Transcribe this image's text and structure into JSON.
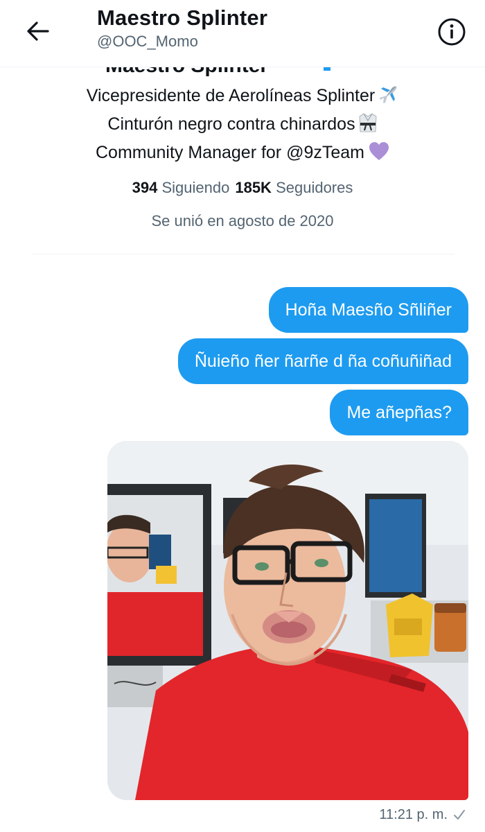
{
  "header": {
    "title": "Maestro Splinter",
    "handle": "@OOC_Momo",
    "back_icon": "arrow-left-icon",
    "info_icon": "info-circle-icon"
  },
  "profile": {
    "name_cutoff": "Maestro Splinter",
    "bio": [
      {
        "text": "Vicepresidente de Aerolíneas Splinter",
        "emoji": "airplane"
      },
      {
        "text": "Cinturón negro contra chinardos",
        "emoji": "martial-arts-uniform"
      },
      {
        "text": "Community Manager for @9zTeam",
        "emoji": "purple-heart"
      }
    ],
    "following_count": "394",
    "following_label": "Siguiendo",
    "followers_count": "185K",
    "followers_label": "Seguidores",
    "joined": "Se unió en agosto de 2020"
  },
  "messages": [
    {
      "text": "Hoña Maesño Sñliñer"
    },
    {
      "text": "Ñuieño ñer ñarñe d ña coñuñiñad"
    },
    {
      "text": "Me añepñas?"
    }
  ],
  "photo": {
    "description_icon": "selfie-photo"
  },
  "meta": {
    "timestamp": "11:21 p. m.",
    "status_icon": "sent-check-icon"
  },
  "colors": {
    "accent": "#1d9bf0",
    "text_primary": "#0f1419",
    "text_secondary": "#536471",
    "divider": "#eff3f4"
  }
}
